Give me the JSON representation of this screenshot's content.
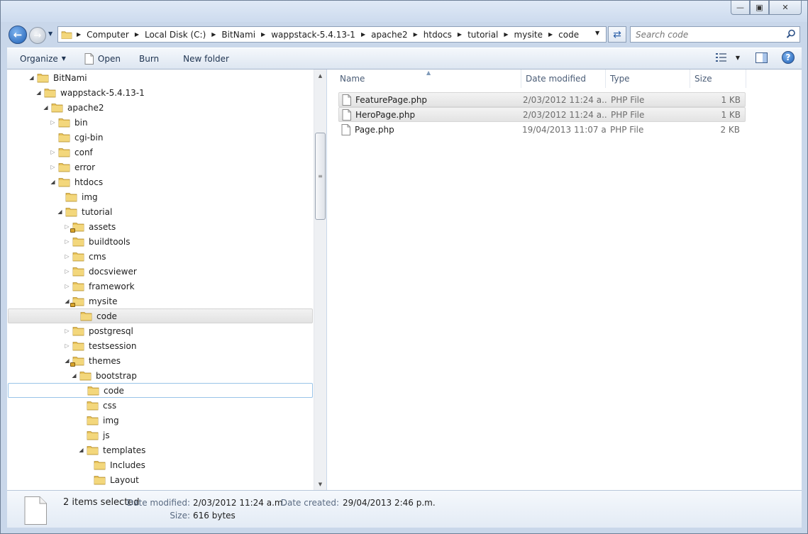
{
  "window": {
    "controls": [
      "minimize",
      "maximize",
      "close"
    ]
  },
  "address": {
    "crumbs": [
      "Computer",
      "Local Disk (C:)",
      "BitNami",
      "wappstack-5.4.13-1",
      "apache2",
      "htdocs",
      "tutorial",
      "mysite",
      "code"
    ]
  },
  "search": {
    "placeholder": "Search code"
  },
  "toolbar": {
    "organize": "Organize",
    "open": "Open",
    "burn": "Burn",
    "new_folder": "New folder"
  },
  "tree": [
    {
      "label": "BitNami",
      "state": "expanded",
      "indent": 0,
      "lock": false
    },
    {
      "label": "wappstack-5.4.13-1",
      "state": "expanded",
      "indent": 1,
      "lock": false
    },
    {
      "label": "apache2",
      "state": "expanded",
      "indent": 2,
      "lock": false
    },
    {
      "label": "bin",
      "state": "collapsed",
      "indent": 3,
      "lock": false
    },
    {
      "label": "cgi-bin",
      "state": "none",
      "indent": 3,
      "lock": false
    },
    {
      "label": "conf",
      "state": "collapsed",
      "indent": 3,
      "lock": false
    },
    {
      "label": "error",
      "state": "collapsed",
      "indent": 3,
      "lock": false
    },
    {
      "label": "htdocs",
      "state": "expanded",
      "indent": 3,
      "lock": false
    },
    {
      "label": "img",
      "state": "none",
      "indent": 4,
      "lock": false
    },
    {
      "label": "tutorial",
      "state": "expanded",
      "indent": 4,
      "lock": false
    },
    {
      "label": "assets",
      "state": "collapsed",
      "indent": 5,
      "lock": true
    },
    {
      "label": "buildtools",
      "state": "collapsed",
      "indent": 5,
      "lock": false
    },
    {
      "label": "cms",
      "state": "collapsed",
      "indent": 5,
      "lock": false
    },
    {
      "label": "docsviewer",
      "state": "collapsed",
      "indent": 5,
      "lock": false
    },
    {
      "label": "framework",
      "state": "collapsed",
      "indent": 5,
      "lock": false
    },
    {
      "label": "mysite",
      "state": "expanded",
      "indent": 5,
      "lock": true
    },
    {
      "label": "code",
      "state": "none",
      "indent": 6,
      "lock": false,
      "selected": true
    },
    {
      "label": "postgresql",
      "state": "collapsed",
      "indent": 5,
      "lock": false
    },
    {
      "label": "testsession",
      "state": "collapsed",
      "indent": 5,
      "lock": false
    },
    {
      "label": "themes",
      "state": "expanded",
      "indent": 5,
      "lock": true
    },
    {
      "label": "bootstrap",
      "state": "expanded",
      "indent": 6,
      "lock": false
    },
    {
      "label": "code",
      "state": "none",
      "indent": 7,
      "lock": false,
      "focused": true
    },
    {
      "label": "css",
      "state": "none",
      "indent": 7,
      "lock": false
    },
    {
      "label": "img",
      "state": "none",
      "indent": 7,
      "lock": false
    },
    {
      "label": "js",
      "state": "none",
      "indent": 7,
      "lock": false
    },
    {
      "label": "templates",
      "state": "expanded",
      "indent": 7,
      "lock": false
    },
    {
      "label": "Includes",
      "state": "none",
      "indent": 8,
      "lock": false
    },
    {
      "label": "Layout",
      "state": "none",
      "indent": 8,
      "lock": false
    }
  ],
  "columns": {
    "name": "Name",
    "date": "Date modified",
    "type": "Type",
    "size": "Size"
  },
  "files": [
    {
      "name": "FeaturePage.php",
      "date": "2/03/2012 11:24 a....",
      "type": "PHP File",
      "size": "1 KB",
      "selected": true
    },
    {
      "name": "HeroPage.php",
      "date": "2/03/2012 11:24 a....",
      "type": "PHP File",
      "size": "1 KB",
      "selected": true
    },
    {
      "name": "Page.php",
      "date": "19/04/2013 11:07 a....",
      "type": "PHP File",
      "size": "2 KB",
      "selected": false
    }
  ],
  "details": {
    "selection": "2 items selected",
    "date_modified_label": "Date modified:",
    "date_modified": "2/03/2012 11:24 a.m.",
    "date_created_label": "Date created:",
    "date_created": "29/04/2013 2:46 p.m.",
    "size_label": "Size:",
    "size": "616 bytes"
  },
  "colors": {
    "folder": "#e8c25a",
    "accent": "#1e5fb5",
    "selection": "#e5e5e5",
    "focus_border": "#99c4e8"
  }
}
